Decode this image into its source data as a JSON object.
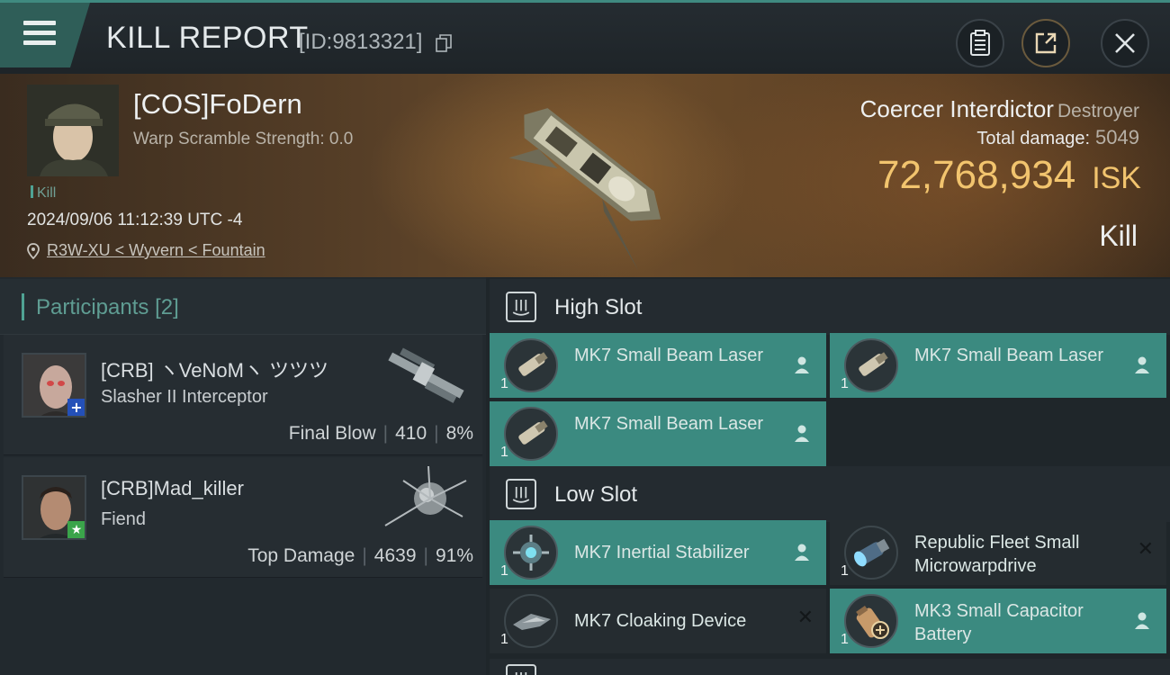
{
  "header": {
    "title": "KILL REPORT",
    "report_id": "[ID:9813321]"
  },
  "victim": {
    "name": "[COS]FoDern",
    "warp_scramble": "Warp Scramble Strength: 0.0",
    "tag": "Kill",
    "datetime": "2024/09/06 11:12:39 UTC -4",
    "location": "R3W-XU < Wyvern < Fountain",
    "ship_name": "Coercer Interdictor",
    "ship_class": "Destroyer",
    "total_damage_label": "Total damage:",
    "total_damage": "5049",
    "isk_value": "72,768,934",
    "isk_unit": "ISK",
    "outcome": "Kill"
  },
  "participants": {
    "label": "Participants",
    "count": "[2]",
    "items": [
      {
        "name": "[CRB] ヽVeNoMヽ ツツツ",
        "ship": "Slasher II Interceptor",
        "role": "Final Blow",
        "damage": "410",
        "percent": "8%"
      },
      {
        "name": "[CRB]Mad_killer",
        "ship": "Fiend",
        "role": "Top Damage",
        "damage": "4639",
        "percent": "91%"
      }
    ]
  },
  "slots": {
    "high": {
      "title": "High Slot",
      "modules": [
        {
          "qty": "1",
          "name": "MK7 Small Beam Laser",
          "state": "fitted"
        },
        {
          "qty": "1",
          "name": "MK7 Small Beam Laser",
          "state": "fitted"
        },
        {
          "qty": "1",
          "name": "MK7 Small Beam Laser",
          "state": "fitted"
        }
      ]
    },
    "low": {
      "title": "Low Slot",
      "modules": [
        {
          "qty": "1",
          "name": "MK7 Inertial Stabilizer",
          "state": "fitted"
        },
        {
          "qty": "1",
          "name": "Republic Fleet Small Microwarpdrive",
          "state": "destroyed"
        },
        {
          "qty": "1",
          "name": "MK7 Cloaking Device",
          "state": "destroyed"
        },
        {
          "qty": "1",
          "name": "MK3 Small Capacitor Battery",
          "state": "fitted"
        }
      ]
    }
  },
  "colors": {
    "accent": "#3b8a80",
    "isk": "#f2c46e",
    "participants_label": "#5f9d93"
  },
  "icons": {
    "menu": "hamburger-icon",
    "copy": "copy-icon",
    "clipboard": "clipboard-icon",
    "share": "share-icon",
    "close": "close-icon",
    "location": "location-pin-icon",
    "slot": "slot-icon",
    "pilot": "person-icon",
    "destroyed": "x-mark-icon"
  }
}
